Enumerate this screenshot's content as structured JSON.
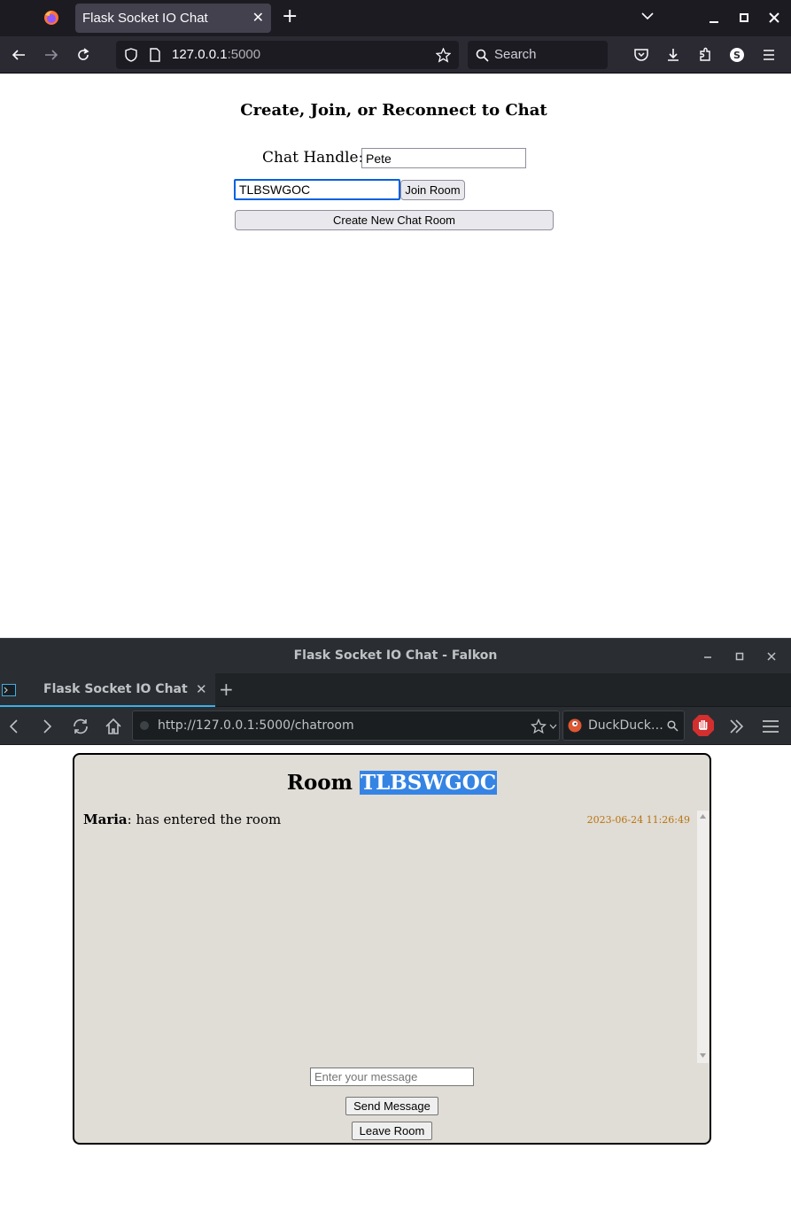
{
  "firefox": {
    "tab_title": "Flask Socket IO Chat",
    "url_host": "127.0.0.1",
    "url_port": ":5000",
    "search_placeholder": "Search",
    "page": {
      "heading": "Create, Join, or Reconnect to Chat",
      "handle_label": "Chat Handle:",
      "handle_value": "Pete",
      "room_code_value": "TLBSWGOC",
      "join_button": "Join Room",
      "create_button": "Create New Chat Room"
    }
  },
  "falkon": {
    "window_title": "Flask Socket IO Chat - Falkon",
    "tab_title": "Flask Socket IO Chat",
    "url": "http://127.0.0.1:5000/chatroom",
    "search_engine": "DuckDuck…",
    "page": {
      "room_prefix": "Room",
      "room_code": "TLBSWGOC",
      "messages": [
        {
          "user": "Maria",
          "text": ": has entered the room",
          "time": "2023-06-24 11:26:49"
        }
      ],
      "message_placeholder": "Enter your message",
      "send_button": "Send Message",
      "leave_button": "Leave Room"
    }
  },
  "colors": {
    "firefox_tabbar": "#1c1b22",
    "firefox_toolbar": "#2b2a33",
    "falkon_chrome": "#2a2e32",
    "chat_bg": "#e0dcd6",
    "selection": "#3584e4",
    "timestamp": "#b8730b"
  }
}
